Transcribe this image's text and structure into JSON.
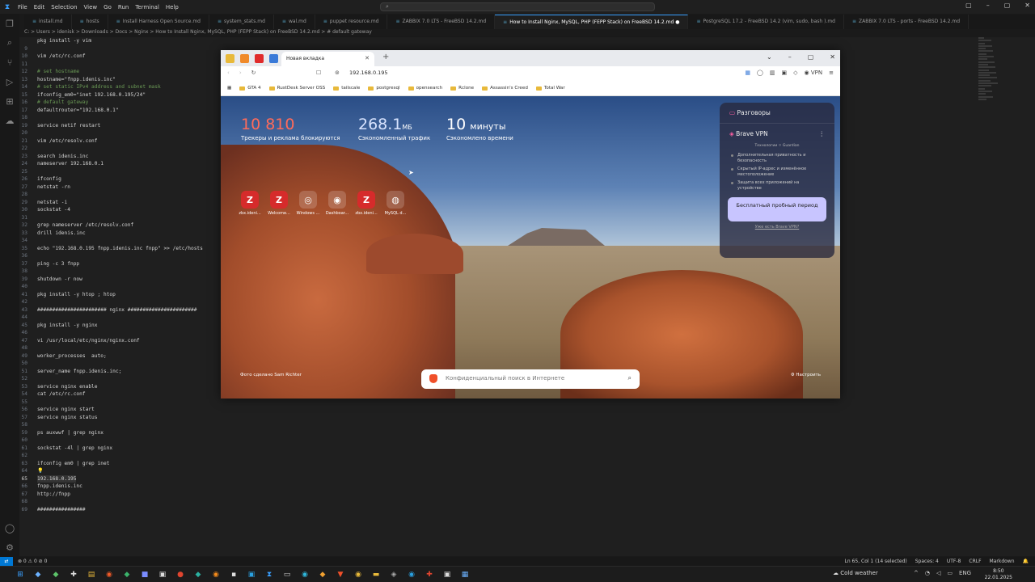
{
  "vscode": {
    "menu": [
      "File",
      "Edit",
      "Selection",
      "View",
      "Go",
      "Run",
      "Terminal",
      "Help"
    ],
    "tabs": [
      {
        "label": "install.md",
        "active": false
      },
      {
        "label": "hosts",
        "active": false
      },
      {
        "label": "Install Harness Open Source.md",
        "active": false
      },
      {
        "label": "system_stats.md",
        "active": false
      },
      {
        "label": "wal.md",
        "active": false
      },
      {
        "label": "puppet resource.md",
        "active": false
      },
      {
        "label": "ZABBIX 7.0 LTS - FreeBSD 14.2.md",
        "active": false
      },
      {
        "label": "How to Install Nginx, MySQL, PHP (FEPP Stack) on FreeBSD 14.2.md",
        "active": true
      },
      {
        "label": "PostgreSQL 17.2 - FreeBSD 14.2 (vim, sudo, bash ).md",
        "active": false
      },
      {
        "label": "ZABBIX 7.0 LTS - ports - FreeBSD 14.2.md",
        "active": false
      }
    ],
    "breadcrumb": "C: > Users > idenisk > Downloads > Docs > Nginx > How to Install Nginx, MySQL, PHP (FEPP Stack) on FreeBSD 14.2.md > # default gateway",
    "code_lines": [
      {
        "n": "",
        "t": "pkg install -y vim",
        "c": ""
      },
      {
        "n": "9",
        "t": "",
        "c": ""
      },
      {
        "n": "10",
        "t": "vim /etc/rc.conf",
        "c": ""
      },
      {
        "n": "11",
        "t": "",
        "c": ""
      },
      {
        "n": "12",
        "t": "# set hostname",
        "c": "cm"
      },
      {
        "n": "13",
        "t": "hostname=\"fnpp.idenis.inc\"",
        "c": ""
      },
      {
        "n": "14",
        "t": "# set static IPv4 address and subnet mask",
        "c": "cm"
      },
      {
        "n": "15",
        "t": "ifconfig_em0=\"inet 192.168.0.195/24\"",
        "c": ""
      },
      {
        "n": "16",
        "t": "# default gateway",
        "c": "cm"
      },
      {
        "n": "17",
        "t": "defaultrouter=\"192.168.0.1\"",
        "c": ""
      },
      {
        "n": "18",
        "t": "",
        "c": ""
      },
      {
        "n": "19",
        "t": "service netif restart",
        "c": ""
      },
      {
        "n": "20",
        "t": "",
        "c": ""
      },
      {
        "n": "21",
        "t": "vim /etc/resolv.conf",
        "c": ""
      },
      {
        "n": "22",
        "t": "",
        "c": ""
      },
      {
        "n": "23",
        "t": "search idenis.inc",
        "c": ""
      },
      {
        "n": "24",
        "t": "nameserver 192.168.0.1",
        "c": ""
      },
      {
        "n": "25",
        "t": "",
        "c": ""
      },
      {
        "n": "26",
        "t": "ifconfig",
        "c": ""
      },
      {
        "n": "27",
        "t": "netstat -rn",
        "c": ""
      },
      {
        "n": "28",
        "t": "",
        "c": ""
      },
      {
        "n": "29",
        "t": "netstat -i",
        "c": ""
      },
      {
        "n": "30",
        "t": "sockstat -4",
        "c": ""
      },
      {
        "n": "31",
        "t": "",
        "c": ""
      },
      {
        "n": "32",
        "t": "grep nameserver /etc/resolv.conf",
        "c": ""
      },
      {
        "n": "33",
        "t": "drill idenis.inc",
        "c": ""
      },
      {
        "n": "34",
        "t": "",
        "c": ""
      },
      {
        "n": "35",
        "t": "echo \"192.168.0.195 fnpp.idenis.inc fnpp\" >> /etc/hosts",
        "c": ""
      },
      {
        "n": "36",
        "t": "",
        "c": ""
      },
      {
        "n": "37",
        "t": "ping -c 3 fnpp",
        "c": ""
      },
      {
        "n": "38",
        "t": "",
        "c": ""
      },
      {
        "n": "39",
        "t": "shutdown -r now",
        "c": ""
      },
      {
        "n": "40",
        "t": "",
        "c": ""
      },
      {
        "n": "41",
        "t": "pkg install -y htop ; htop",
        "c": ""
      },
      {
        "n": "42",
        "t": "",
        "c": ""
      },
      {
        "n": "43",
        "t": "####################### nginx #######################",
        "c": ""
      },
      {
        "n": "44",
        "t": "",
        "c": ""
      },
      {
        "n": "45",
        "t": "pkg install -y nginx",
        "c": ""
      },
      {
        "n": "46",
        "t": "",
        "c": ""
      },
      {
        "n": "47",
        "t": "vi /usr/local/etc/nginx/nginx.conf",
        "c": ""
      },
      {
        "n": "48",
        "t": "",
        "c": ""
      },
      {
        "n": "49",
        "t": "worker_processes  auto;",
        "c": ""
      },
      {
        "n": "50",
        "t": "",
        "c": ""
      },
      {
        "n": "51",
        "t": "server_name fnpp.idenis.inc;",
        "c": ""
      },
      {
        "n": "52",
        "t": "",
        "c": ""
      },
      {
        "n": "53",
        "t": "service nginx enable",
        "c": ""
      },
      {
        "n": "54",
        "t": "cat /etc/rc.conf",
        "c": ""
      },
      {
        "n": "55",
        "t": "",
        "c": ""
      },
      {
        "n": "56",
        "t": "service nginx start",
        "c": ""
      },
      {
        "n": "57",
        "t": "service nginx status",
        "c": ""
      },
      {
        "n": "58",
        "t": "",
        "c": ""
      },
      {
        "n": "59",
        "t": "ps auxwwf | grep nginx",
        "c": ""
      },
      {
        "n": "60",
        "t": "",
        "c": ""
      },
      {
        "n": "61",
        "t": "sockstat -4l | grep nginx",
        "c": ""
      },
      {
        "n": "62",
        "t": "",
        "c": ""
      },
      {
        "n": "63",
        "t": "ifconfig em0 | grep inet",
        "c": ""
      },
      {
        "n": "64",
        "t": "💡",
        "c": ""
      },
      {
        "n": "65",
        "t": "192.168.0.195",
        "c": "hl"
      },
      {
        "n": "66",
        "t": "fnpp.idenis.inc",
        "c": ""
      },
      {
        "n": "67",
        "t": "http://fnpp",
        "c": ""
      },
      {
        "n": "68",
        "t": "",
        "c": ""
      },
      {
        "n": "69",
        "t": "################",
        "c": ""
      }
    ],
    "status": {
      "left": "⊗ 0 ⚠ 0   ⊘ 0",
      "position": "Ln 65, Col 1 (14 selected)",
      "spaces": "Spaces: 4",
      "encoding": "UTF-8",
      "eol": "CRLF",
      "language": "Markdown"
    }
  },
  "browser": {
    "tab_title": "Новая вкладка",
    "url": "192.168.0.195",
    "vpn_label": "VPN",
    "bookmarks": [
      "GTA 4",
      "RustDesk Server OSS",
      "tailscale",
      "postgresql",
      "opensearch",
      "Rclone",
      "Assassin's Creed",
      "Total War"
    ],
    "stats": [
      {
        "value": "10 810",
        "unit": "",
        "label": "Трекеры и реклама блокируются",
        "color": "#ff6b5a"
      },
      {
        "value": "268.1",
        "unit": "МБ",
        "label": "Сэкономленный трафик",
        "color": "#d8e4ff"
      },
      {
        "value": "10",
        "unit": "минуты",
        "label": "Сэкономлено времени",
        "color": "#ffffff"
      }
    ],
    "tiles": [
      {
        "label": "zbx.ideni...",
        "icon": "Z"
      },
      {
        "label": "Welcome...",
        "icon": "Z"
      },
      {
        "label": "Windows ...",
        "icon": "◎"
      },
      {
        "label": "Dashboar...",
        "icon": "◉"
      },
      {
        "label": "zbx.ideni...",
        "icon": "Z"
      },
      {
        "label": "MySQL d...",
        "icon": "◍"
      }
    ],
    "sidebar": {
      "conversations": "Разговоры",
      "vpn_title": "Brave VPN",
      "powered": "Технологии ⚪ Guardian",
      "features": [
        "Дополнительная приватность и безопасность",
        "Скрытый IP-адрес и изменённое местоположение",
        "Защита всех приложений на устройстве"
      ],
      "cta": "Бесплатный пробный период",
      "have": "Уже есть Brave VPN?"
    },
    "search_placeholder": "Конфиденциальный поиск в Интернете",
    "photo_credit": "Фото сделано Sam Richter",
    "customize": "Настроить"
  },
  "taskbar": {
    "weather": "Cold weather",
    "lang": "ENG",
    "time": "8:50",
    "date": "22.01.2025"
  }
}
